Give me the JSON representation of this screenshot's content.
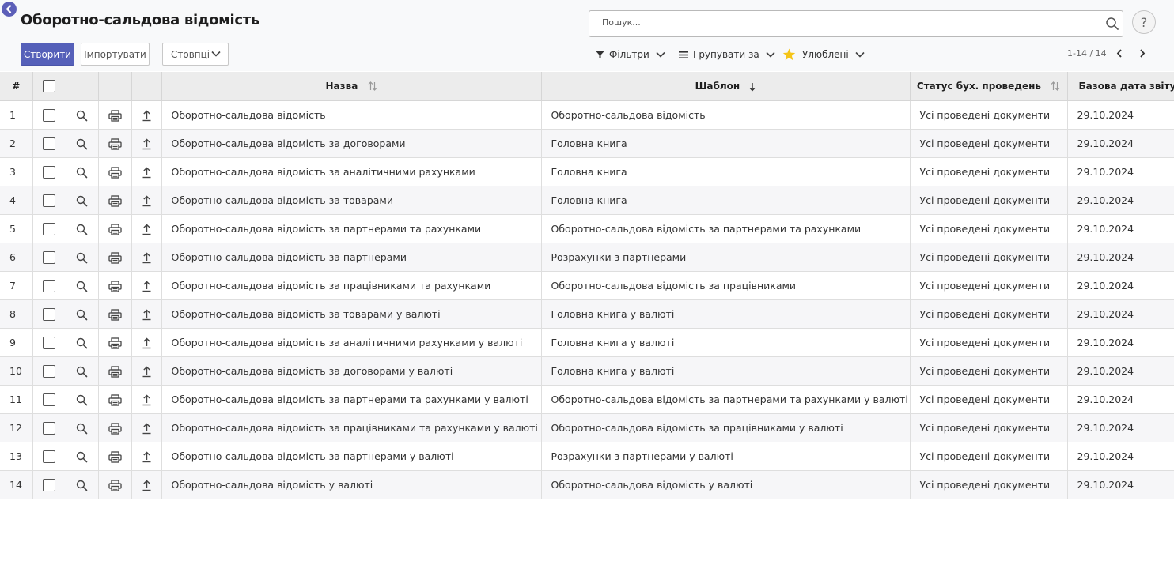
{
  "page": {
    "title": "Оборотно-сальдова відомість"
  },
  "toolbar": {
    "create_label": "Створити",
    "import_label": "Імпортувати",
    "columns_label": "Стовпці"
  },
  "search": {
    "placeholder": "Пошук..."
  },
  "help": {
    "label": "?"
  },
  "filters": {
    "filters_label": "Фільтри",
    "group_label": "Групувати за",
    "favorites_label": "Улюблені"
  },
  "pager": {
    "text": "1-14 / 14"
  },
  "colors": {
    "accent": "#5560b9",
    "star": "#f5c518"
  },
  "table": {
    "headers": {
      "num": "#",
      "name": "Назва",
      "template": "Шаблон",
      "status": "Статус бух. проведень",
      "date": "Базова дата звіту"
    },
    "rows": [
      {
        "num": "1",
        "name": "Оборотно-сальдова відомість",
        "template": "Оборотно-сальдова відомість",
        "status": "Усі проведені документи",
        "date": "29.10.2024"
      },
      {
        "num": "2",
        "name": "Оборотно-сальдова відомість за договорами",
        "template": "Головна книга",
        "status": "Усі проведені документи",
        "date": "29.10.2024"
      },
      {
        "num": "3",
        "name": "Оборотно-сальдова відомість за аналітичними рахунками",
        "template": "Головна книга",
        "status": "Усі проведені документи",
        "date": "29.10.2024"
      },
      {
        "num": "4",
        "name": "Оборотно-сальдова відомість за товарами",
        "template": "Головна книга",
        "status": "Усі проведені документи",
        "date": "29.10.2024"
      },
      {
        "num": "5",
        "name": "Оборотно-сальдова відомість за партнерами та рахунками",
        "template": "Оборотно-сальдова відомість за партнерами та рахунками",
        "status": "Усі проведені документи",
        "date": "29.10.2024"
      },
      {
        "num": "6",
        "name": "Оборотно-сальдова відомість за партнерами",
        "template": "Розрахунки з партнерами",
        "status": "Усі проведені документи",
        "date": "29.10.2024"
      },
      {
        "num": "7",
        "name": "Оборотно-сальдова відомість за працівниками та рахунками",
        "template": "Оборотно-сальдова відомість за працівниками",
        "status": "Усі проведені документи",
        "date": "29.10.2024"
      },
      {
        "num": "8",
        "name": "Оборотно-сальдова відомість за товарами у валюті",
        "template": "Головна книга у валюті",
        "status": "Усі проведені документи",
        "date": "29.10.2024"
      },
      {
        "num": "9",
        "name": "Оборотно-сальдова відомість за аналітичними рахунками у валюті",
        "template": "Головна книга у валюті",
        "status": "Усі проведені документи",
        "date": "29.10.2024"
      },
      {
        "num": "10",
        "name": "Оборотно-сальдова відомість за договорами у валюті",
        "template": "Головна книга у валюті",
        "status": "Усі проведені документи",
        "date": "29.10.2024"
      },
      {
        "num": "11",
        "name": "Оборотно-сальдова відомість за партнерами та рахунками у валюті",
        "template": "Оборотно-сальдова відомість за партнерами та рахунками у валюті",
        "status": "Усі проведені документи",
        "date": "29.10.2024"
      },
      {
        "num": "12",
        "name": "Оборотно-сальдова відомість за працівниками та рахунками у валюті",
        "template": "Оборотно-сальдова відомість за працівниками у валюті",
        "status": "Усі проведені документи",
        "date": "29.10.2024"
      },
      {
        "num": "13",
        "name": "Оборотно-сальдова відомість за партнерами у валюті",
        "template": "Розрахунки з партнерами у валюті",
        "status": "Усі проведені документи",
        "date": "29.10.2024"
      },
      {
        "num": "14",
        "name": "Оборотно-сальдова відомість у валюті",
        "template": "Оборотно-сальдова відомість у валюті",
        "status": "Усі проведені документи",
        "date": "29.10.2024"
      }
    ]
  }
}
